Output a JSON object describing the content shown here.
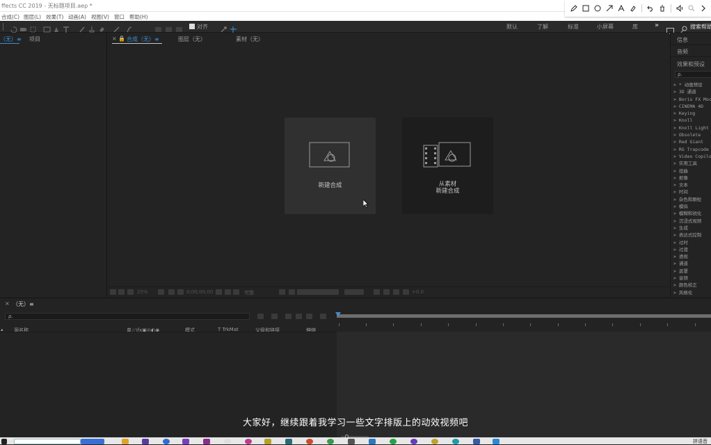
{
  "window": {
    "title": "ffects CC 2019 - 无标题项目.aep *"
  },
  "menu": [
    "合成(C)",
    "图层(L)",
    "效果(T)",
    "动画(A)",
    "视图(V)",
    "窗口",
    "帮助(H)"
  ],
  "annotation_toolbar": {
    "icons": [
      "pencil-icon",
      "rectangle-icon",
      "circle-icon",
      "arrow-icon",
      "text-icon",
      "highlighter-icon",
      "undo-icon",
      "delete-icon",
      "speaker-icon",
      "zoom-icon",
      "chevron-right-icon"
    ]
  },
  "toolbar": {
    "align_label": "对齐",
    "workspaces": [
      "默认",
      "了解",
      "标准",
      "小屏幕",
      "库"
    ],
    "overflow": "»",
    "search_label": "搜索帮助"
  },
  "project_panel": {
    "tab_prefix": "（无）≡",
    "tab_project": "项目"
  },
  "composition_panel": {
    "tab_comp": "合成（无）≡",
    "tab_layer": "图层（无）",
    "tab_footage": "素材（无）",
    "card_new": "新建合成",
    "card_from_footage_line1": "从素材",
    "card_from_footage_line2": "新建合成",
    "footer_zoom": "25%",
    "footer_time": "0;00;00;00",
    "footer_res": "完整",
    "footer_exposure": "+0.0"
  },
  "right_panel": {
    "info": "信息",
    "audio": "音频",
    "effects": "效果和预设",
    "search_placeholder": "ρ.",
    "effects_list": [
      "> * 动画预设",
      "> 3D 通道",
      "> Boris FX Mocha",
      "> CINEMA 4D",
      "> Keying",
      "> Knoll",
      "> Knoll Light Fa",
      "> Obsolete",
      "> Red Giant",
      "> RG Trapcode",
      "> Video Copilot",
      "> 实用工具",
      "> 扭曲",
      "> 抠像",
      "> 文本",
      "> 时间",
      "> 杂色和颗粒",
      "> 模拟",
      "> 模糊和锐化",
      "> 沉浸式视频",
      "> 生成",
      "> 表达式控制",
      "> 过时",
      "> 过渡",
      "> 透视",
      "> 通道",
      "> 遮罩",
      "> 音频",
      "> 颜色校正",
      "> 风格化"
    ]
  },
  "timeline": {
    "tab": "（无）≡",
    "search_placeholder": "ρ.",
    "col_source": "源名称",
    "col_switches": "单☆\\fx▣◎◐◉",
    "col_mode": "模式",
    "col_trkmat": "T TrkMat",
    "col_parent": "父级和链接",
    "col_stretch": "伸缩"
  },
  "subtitle": "大家好，继续跟着我学习一些文字排版上的动效视频吧",
  "taskbar": {
    "tray_text": "拼语音"
  }
}
